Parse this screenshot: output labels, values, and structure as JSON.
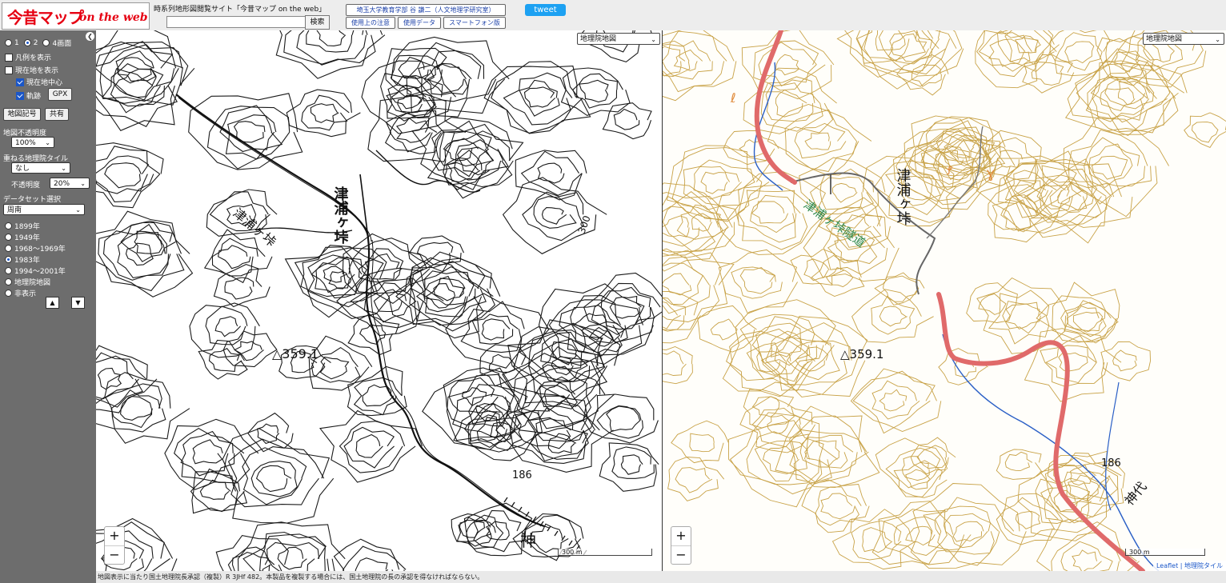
{
  "header": {
    "logo_main": "今昔マップ",
    "logo_sub": "on the web",
    "site_title": "時系列地形図閲覧サイト「今昔マップ on the web」",
    "search": {
      "value": "",
      "placeholder": ""
    },
    "search_button": "検索",
    "links": [
      "埼玉大学教育学部 谷 謙二（人文地理学研究室）",
      "使用上の注意",
      "使用データ",
      "スマートフォン版"
    ],
    "tweet": "tweet"
  },
  "sidebar": {
    "panel_modes": [
      "1",
      "2",
      "4画面"
    ],
    "selected_panel_mode": "2",
    "checkboxes": [
      {
        "label": "凡例を表示",
        "checked": false
      },
      {
        "label": "現在地を表示",
        "checked": false
      },
      {
        "label": "現在地中心",
        "checked": true
      },
      {
        "label": "軌跡",
        "checked": true
      }
    ],
    "gpx_button": "GPX",
    "legend_button": "地図記号",
    "share_button": "共有",
    "opacity_label": "地図不透明度",
    "opacity_value": "100%",
    "overlay_label": "重ねる地理院タイル",
    "overlay_value": "なし",
    "overlay_opacity_label": "不透明度",
    "overlay_opacity_value": "20%",
    "dataset_label": "データセット選択",
    "dataset_value": "周南",
    "eras": [
      "1899年",
      "1949年",
      "1968～1969年",
      "1983年",
      "1994～2001年",
      "地理院地図",
      "非表示"
    ],
    "selected_era": "1983年",
    "up_arrow": "▲",
    "down_arrow": "▼"
  },
  "map_left": {
    "layer_select": "地理院地図",
    "labels": {
      "place": "津浦ヶ垰",
      "summit": "△359.1",
      "elev_300": "300",
      "elev_186": "186",
      "kami": "神"
    },
    "zoom_in": "+",
    "zoom_out": "−",
    "scale": "300 m"
  },
  "map_right": {
    "layer_select": "地理院地図",
    "labels": {
      "place": "津浦ヶ垰",
      "tunnel": "津浦ヶ垰隧道",
      "summit": "△359.1",
      "elev_186": "186",
      "kamishiro": "神代"
    },
    "zoom_in": "+",
    "zoom_out": "−",
    "scale": "300 m",
    "attribution": "Leaflet | 地理院タイル"
  },
  "footer": {
    "text": "地図表示に当たり国土地理院長承認（複製）R 3JHf 482。本製品を複製する場合には、国土地理院の長の承認を得なければならない。"
  },
  "colors": {
    "route": "#e06a6a",
    "river": "#2a5fc6",
    "contour_new": "#c8a247",
    "tunnel_label": "#2f8a4e",
    "sidebar_bg": "#6d6d6d",
    "tweet": "#1da1f2"
  },
  "icons": {
    "collapse": "chevron-left-icon"
  }
}
